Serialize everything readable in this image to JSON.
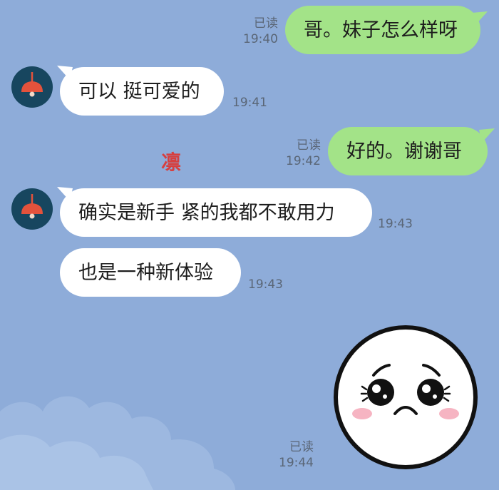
{
  "messages": [
    {
      "id": "m1",
      "dir": "out",
      "text": "哥。妹子怎么样呀",
      "read": "已读",
      "time": "19:40"
    },
    {
      "id": "m2",
      "dir": "in",
      "text": "可以 挺可爱的",
      "time": "19:41"
    },
    {
      "id": "m3",
      "dir": "out",
      "text": "好的。谢谢哥",
      "read": "已读",
      "time": "19:42"
    },
    {
      "id": "m4",
      "dir": "in",
      "text": "确实是新手 紧的我都不敢用力",
      "time": "19:43"
    },
    {
      "id": "m5",
      "dir": "in",
      "text": "也是一种新体验",
      "time": "19:43"
    },
    {
      "id": "m6",
      "dir": "out",
      "sticker": "crying-face-sticker",
      "read": "已读",
      "time": "19:44"
    }
  ],
  "watermark": "凛",
  "colors": {
    "background": "#8eacd9",
    "outgoing_bubble": "#a3e388",
    "incoming_bubble": "#ffffff",
    "avatar_bg": "#17465f",
    "lamp": "#e4523c"
  }
}
